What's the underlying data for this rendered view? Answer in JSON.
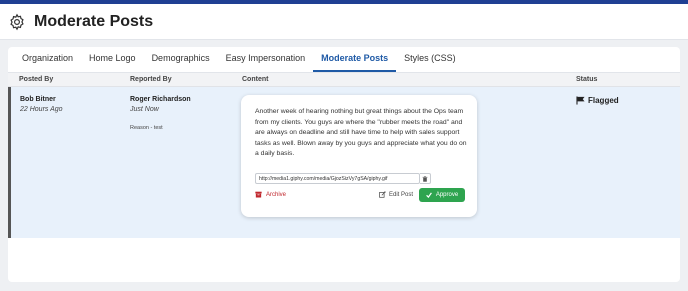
{
  "page": {
    "title": "Moderate Posts"
  },
  "tabs": [
    {
      "label": "Organization"
    },
    {
      "label": "Home Logo"
    },
    {
      "label": "Demographics"
    },
    {
      "label": "Easy Impersonation"
    },
    {
      "label": "Moderate Posts",
      "active": true
    },
    {
      "label": "Styles (CSS)"
    }
  ],
  "table": {
    "headers": {
      "posted_by": "Posted By",
      "reported_by": "Reported By",
      "content": "Content",
      "status": "Status"
    },
    "rows": [
      {
        "posted_by": {
          "name": "Bob Bitner",
          "time": "22 Hours Ago"
        },
        "reported_by": {
          "name": "Roger Richardson",
          "time": "Just Now",
          "reason": "Reason - test"
        },
        "content": {
          "text": "Another week of hearing nothing but great things about the Ops team from my clients. You guys are where the \"rubber meets the road\" and are always on deadline and still have time to help with sales support tasks as well. Blown away by you guys and appreciate what you do on a daily basis.",
          "url": "http://media1.giphy.com/media/GjozSizVy7gSA/giphy.gif",
          "archive_label": "Archive",
          "edit_label": "Edit Post",
          "approve_label": "Approve"
        },
        "status": {
          "label": "Flagged",
          "icon": "flag-icon"
        }
      }
    ]
  },
  "colors": {
    "brand": "#1f3f93",
    "active_tab": "#1f5aa6",
    "approve": "#2ea44f",
    "archive": "#c0272d",
    "row_highlight": "#e8f1fb"
  }
}
